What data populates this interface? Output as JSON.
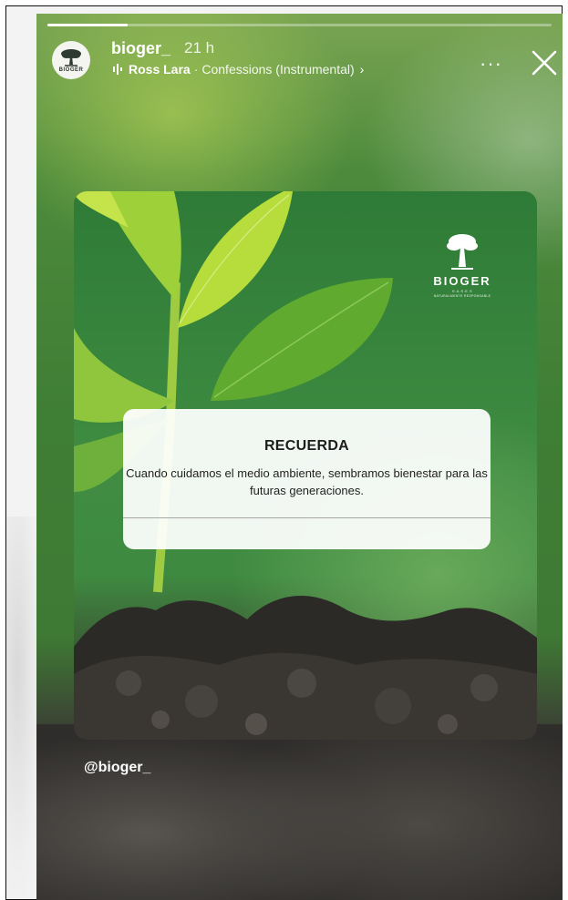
{
  "story": {
    "progress": 0.16,
    "user": {
      "username": "bioger_",
      "time": "21 h",
      "avatar_text": "BIOGER"
    },
    "music": {
      "artist": "Ross Lara",
      "separator": "·",
      "title": "Confessions (Instrumental)",
      "chevron": "›"
    },
    "more_glyph": "···",
    "post": {
      "brand_name": "BIOGER",
      "brand_sub": "S.A.S.E.S",
      "brand_tagline": "NATURALMENTE RESPONSABLE",
      "quote_title": "RECUERDA",
      "quote_body": "Cuando cuidamos el medio ambiente, sembramos bienestar para las futuras generaciones."
    },
    "mention": "@bioger_"
  },
  "icons": [
    "music-bars-icon",
    "more-icon",
    "close-icon",
    "tree-logo-icon"
  ],
  "colors": {
    "accent_green": "#3f8c42",
    "text_white": "#ffffff",
    "card_white": "#ffffff"
  }
}
